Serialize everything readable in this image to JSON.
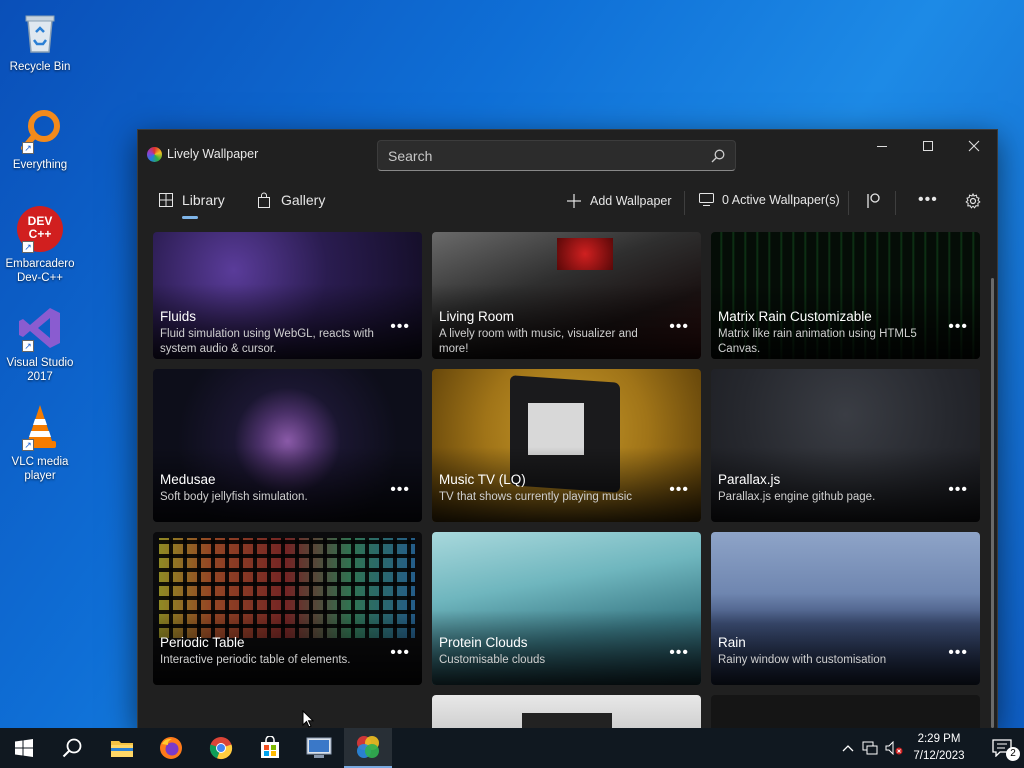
{
  "desktop": {
    "icons": [
      {
        "label": "Recycle Bin",
        "icon": "recycle-bin-icon"
      },
      {
        "label": "Everything",
        "icon": "everything-search-icon"
      },
      {
        "label": "Embarcadero Dev-C++",
        "icon": "devcpp-icon",
        "logo_text": "DEV C++"
      },
      {
        "label": "Visual Studio 2017",
        "icon": "visual-studio-icon"
      },
      {
        "label": "VLC media player",
        "icon": "vlc-icon"
      }
    ]
  },
  "window": {
    "title": "Lively Wallpaper",
    "search_placeholder": "Search",
    "tabs": [
      {
        "label": "Library",
        "icon": "grid-icon",
        "active": true
      },
      {
        "label": "Gallery",
        "icon": "shopping-bag-icon",
        "active": false
      }
    ],
    "toolbar": {
      "add_label": "Add Wallpaper",
      "active_label": "0 Active Wallpaper(s)"
    },
    "wallpapers": [
      {
        "title": "Fluids",
        "desc": "Fluid simulation using WebGL, reacts with system audio & cursor."
      },
      {
        "title": "Living Room",
        "desc": "A lively room with music, visualizer and more!"
      },
      {
        "title": "Matrix Rain Customizable",
        "desc": "Matrix like rain animation using HTML5 Canvas."
      },
      {
        "title": "Medusae",
        "desc": "Soft body jellyfish simulation."
      },
      {
        "title": "Music TV (LQ)",
        "desc": "TV that shows currently playing music"
      },
      {
        "title": "Parallax.js",
        "desc": "Parallax.js engine github page."
      },
      {
        "title": "Periodic Table",
        "desc": "Interactive periodic table of elements."
      },
      {
        "title": "Protein Clouds",
        "desc": "Customisable clouds"
      },
      {
        "title": "Rain",
        "desc": "Rainy window with customisation"
      }
    ],
    "more_glyph": "•••"
  },
  "taskbar": {
    "time": "2:29 PM",
    "date": "7/12/2023",
    "notification_count": "2"
  },
  "colors": {
    "accent": "#7fb5e8",
    "window_bg": "#202020",
    "taskbar_bg": "#101820"
  }
}
